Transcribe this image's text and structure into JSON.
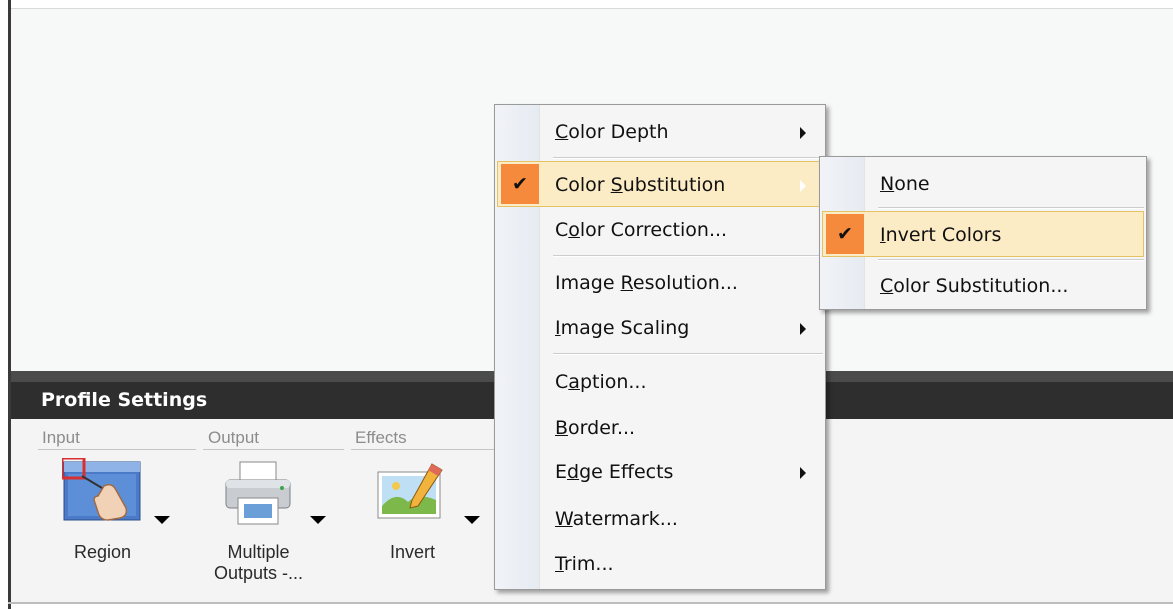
{
  "panel": {
    "title": "Profile Settings"
  },
  "sections": {
    "input": "Input",
    "output": "Output",
    "effects": "Effects"
  },
  "tools": [
    {
      "label": "Region",
      "icon": "region-capture-icon"
    },
    {
      "label_line1": "Multiple",
      "label_line2": "Outputs -...",
      "icon": "printer-icon"
    },
    {
      "label": "Invert",
      "icon": "image-edit-icon"
    }
  ],
  "main_menu": {
    "items": [
      {
        "pre": "",
        "key": "C",
        "post": "olor Depth",
        "has_submenu": true
      },
      {
        "pre": "Color ",
        "key": "S",
        "post": "ubstitution",
        "has_submenu": true,
        "checked": true,
        "highlighted": true
      },
      {
        "pre": "C",
        "key": "o",
        "post": "lor Correction...",
        "has_submenu": false
      },
      {
        "pre": "Image ",
        "key": "R",
        "post": "esolution...",
        "has_submenu": false
      },
      {
        "pre": "",
        "key": "I",
        "post": "mage Scaling",
        "has_submenu": true
      },
      {
        "pre": "C",
        "key": "a",
        "post": "ption...",
        "has_submenu": false
      },
      {
        "pre": "",
        "key": "B",
        "post": "order...",
        "has_submenu": false
      },
      {
        "pre": "E",
        "key": "d",
        "post": "ge Effects",
        "has_submenu": true
      },
      {
        "pre": "",
        "key": "W",
        "post": "atermark...",
        "has_submenu": false
      },
      {
        "pre": "",
        "key": "T",
        "post": "rim...",
        "has_submenu": false
      }
    ]
  },
  "sub_menu": {
    "items": [
      {
        "pre": "",
        "key": "N",
        "post": "one"
      },
      {
        "pre": "",
        "key": "I",
        "post": "nvert Colors",
        "checked": true,
        "highlighted": true
      },
      {
        "pre": "",
        "key": "C",
        "post": "olor Substitution..."
      }
    ]
  },
  "colors": {
    "highlight": "#fcecc5",
    "check_bg": "#f58a3c",
    "header_bg": "#2e2e2e"
  }
}
